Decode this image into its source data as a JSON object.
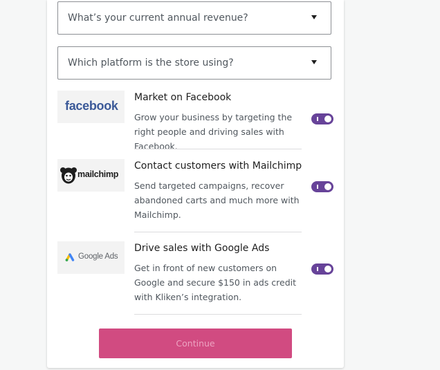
{
  "form": {
    "revenue_select": {
      "label": "What’s your current annual revenue?"
    },
    "platform_select": {
      "label": "Which platform is the store using?"
    }
  },
  "extensions": [
    {
      "logo_text": "facebook",
      "title": "Market on Facebook",
      "description": "Grow your business by targeting the right people and driving sales with Facebook.",
      "enabled": true
    },
    {
      "logo_text": "mailchimp",
      "title": "Contact customers with Mailchimp",
      "description": "Send targeted campaigns, recover abandoned carts and much more with Mailchimp.",
      "enabled": true
    },
    {
      "logo_text": "Google Ads",
      "title": "Drive sales with Google Ads",
      "description": "Get in front of new customers on Google and secure $150 in ads credit with Kliken’s integration.",
      "enabled": true
    }
  ],
  "continue_label": "Continue",
  "colors": {
    "toggle_on": "#674399",
    "continue_bg": "#d14b81",
    "facebook_blue": "#3b5998"
  }
}
